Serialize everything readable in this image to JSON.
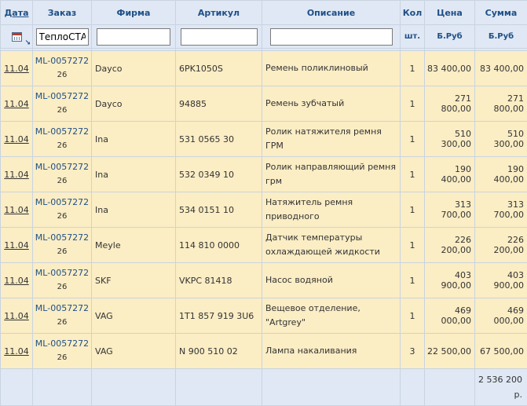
{
  "columns": {
    "date": "Дата",
    "order": "Заказ",
    "firm": "Фирма",
    "article": "Артикул",
    "description": "Описание",
    "qty": "Кол",
    "price": "Цена",
    "sum": "Сумма"
  },
  "filters": {
    "order_value": "ТеплоСТА",
    "firm_value": "",
    "article_value": "",
    "description_value": "",
    "qty_unit": "шт.",
    "price_unit": "Б.Руб",
    "sum_unit": "Б.Руб"
  },
  "rows": [
    {
      "date": "11.04",
      "order": "ML-0057272",
      "order_sub": "26",
      "firm": "Dayco",
      "article": "6PK1050S",
      "description": "Ремень поликлиновый",
      "qty": "1",
      "price": "83 400,00",
      "sum": "83 400,00"
    },
    {
      "date": "11.04",
      "order": "ML-0057272",
      "order_sub": "26",
      "firm": "Dayco",
      "article": "94885",
      "description": "Ремень зубчатый",
      "qty": "1",
      "price": "271 800,00",
      "sum": "271 800,00"
    },
    {
      "date": "11.04",
      "order": "ML-0057272",
      "order_sub": "26",
      "firm": "Ina",
      "article": "531 0565 30",
      "description": "Ролик натяжителя ремня ГРМ",
      "qty": "1",
      "price": "510 300,00",
      "sum": "510 300,00"
    },
    {
      "date": "11.04",
      "order": "ML-0057272",
      "order_sub": "26",
      "firm": "Ina",
      "article": "532 0349 10",
      "description": "Ролик направляющий ремня грм",
      "qty": "1",
      "price": "190 400,00",
      "sum": "190 400,00"
    },
    {
      "date": "11.04",
      "order": "ML-0057272",
      "order_sub": "26",
      "firm": "Ina",
      "article": "534 0151 10",
      "description": "Натяжитель ремня приводного",
      "qty": "1",
      "price": "313 700,00",
      "sum": "313 700,00"
    },
    {
      "date": "11.04",
      "order": "ML-0057272",
      "order_sub": "26",
      "firm": "Meyle",
      "article": "114 810 0000",
      "description": "Датчик температуры охлаждающей жидкости",
      "qty": "1",
      "price": "226 200,00",
      "sum": "226 200,00"
    },
    {
      "date": "11.04",
      "order": "ML-0057272",
      "order_sub": "26",
      "firm": "SKF",
      "article": "VKPC 81418",
      "description": "Насос водяной",
      "qty": "1",
      "price": "403 900,00",
      "sum": "403 900,00"
    },
    {
      "date": "11.04",
      "order": "ML-0057272",
      "order_sub": "26",
      "firm": "VAG",
      "article": "1T1 857 919 3U6",
      "description": "Вещевое отделение, \"Artgrey\"",
      "qty": "1",
      "price": "469 000,00",
      "sum": "469 000,00"
    },
    {
      "date": "11.04",
      "order": "ML-0057272",
      "order_sub": "26",
      "firm": "VAG",
      "article": "N 900 510 02",
      "description": "Лампа накаливания",
      "qty": "3",
      "price": "22 500,00",
      "sum": "67 500,00"
    }
  ],
  "footer": {
    "total": "2 536 200",
    "total_unit": "р."
  },
  "icons": {
    "date_filter": "calendar-icon"
  }
}
